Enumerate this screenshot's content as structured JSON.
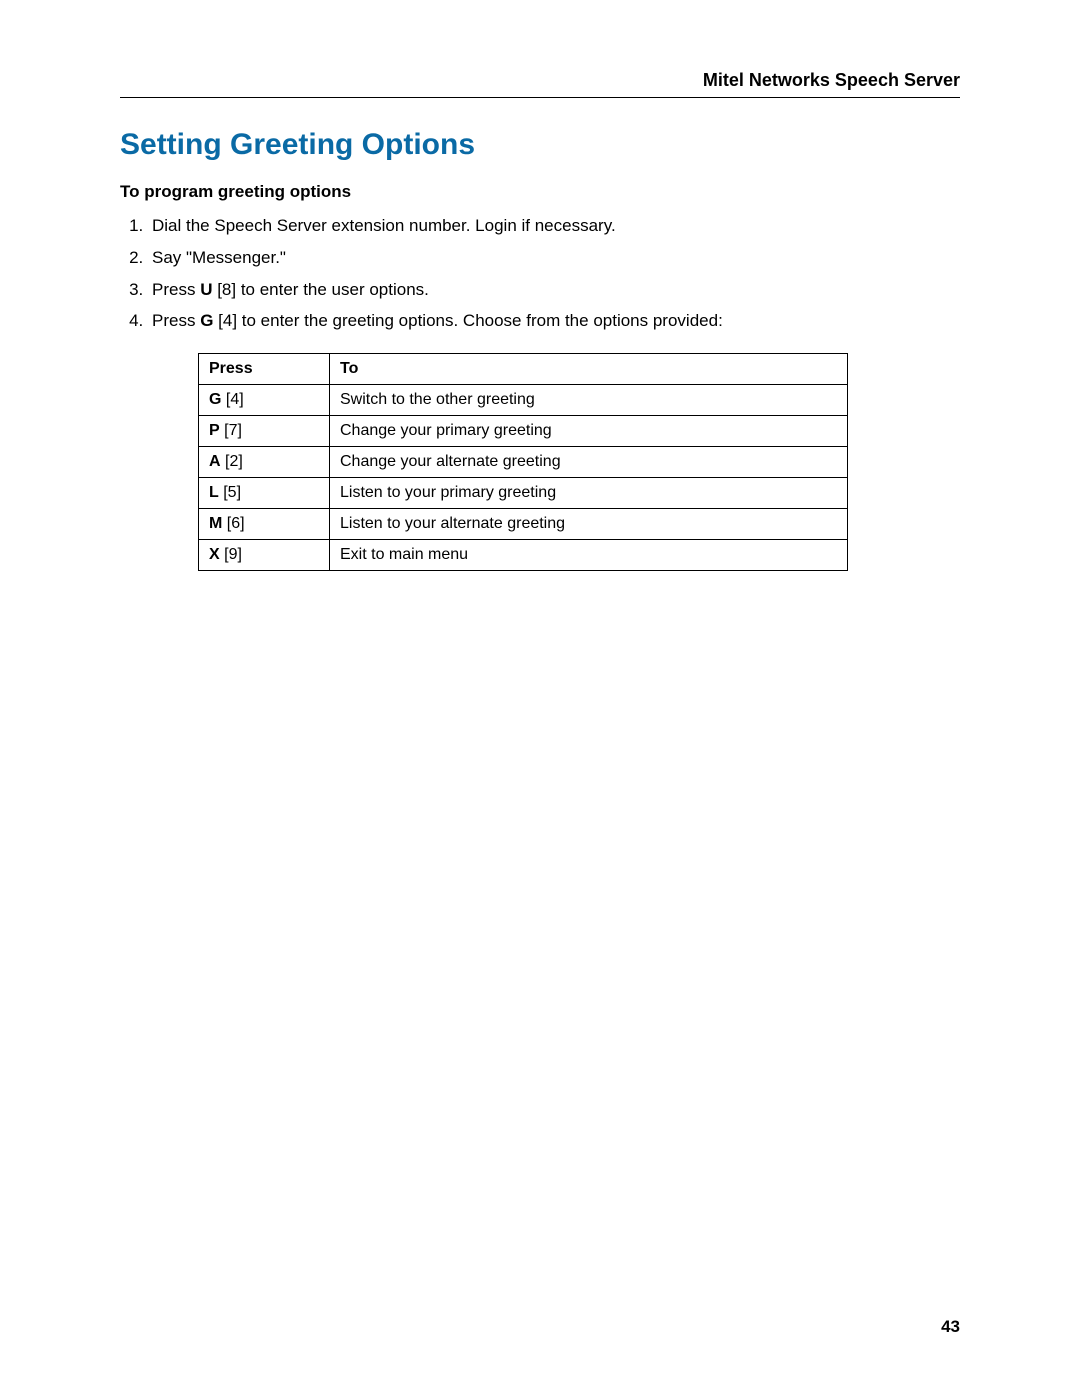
{
  "header": {
    "title": "Mitel Networks Speech Server"
  },
  "section": {
    "title": "Setting Greeting Options",
    "subheading": "To program greeting options"
  },
  "steps": {
    "s1": "Dial the Speech Server extension number. Login if necessary.",
    "s2": "Say \"Messenger.\"",
    "s3_pre": "Press ",
    "s3_key": "U",
    "s3_post": " [8] to enter the user options.",
    "s4_pre": "Press ",
    "s4_key": "G",
    "s4_post": " [4] to enter the greeting options.  Choose from the options provided:"
  },
  "table": {
    "head_press": "Press",
    "head_to": "To",
    "rows": [
      {
        "key": "G",
        "num": " [4]",
        "desc": "Switch to the other greeting"
      },
      {
        "key": "P",
        "num": " [7]",
        "desc": "Change your primary greeting"
      },
      {
        "key": "A",
        "num": " [2]",
        "desc": "Change your alternate greeting"
      },
      {
        "key": "L",
        "num": " [5]",
        "desc": "Listen to your primary greeting"
      },
      {
        "key": "M",
        "num": " [6]",
        "desc": "Listen to your alternate greeting"
      },
      {
        "key": "X",
        "num": " [9]",
        "desc": "Exit to main menu"
      }
    ]
  },
  "page_number": "43"
}
